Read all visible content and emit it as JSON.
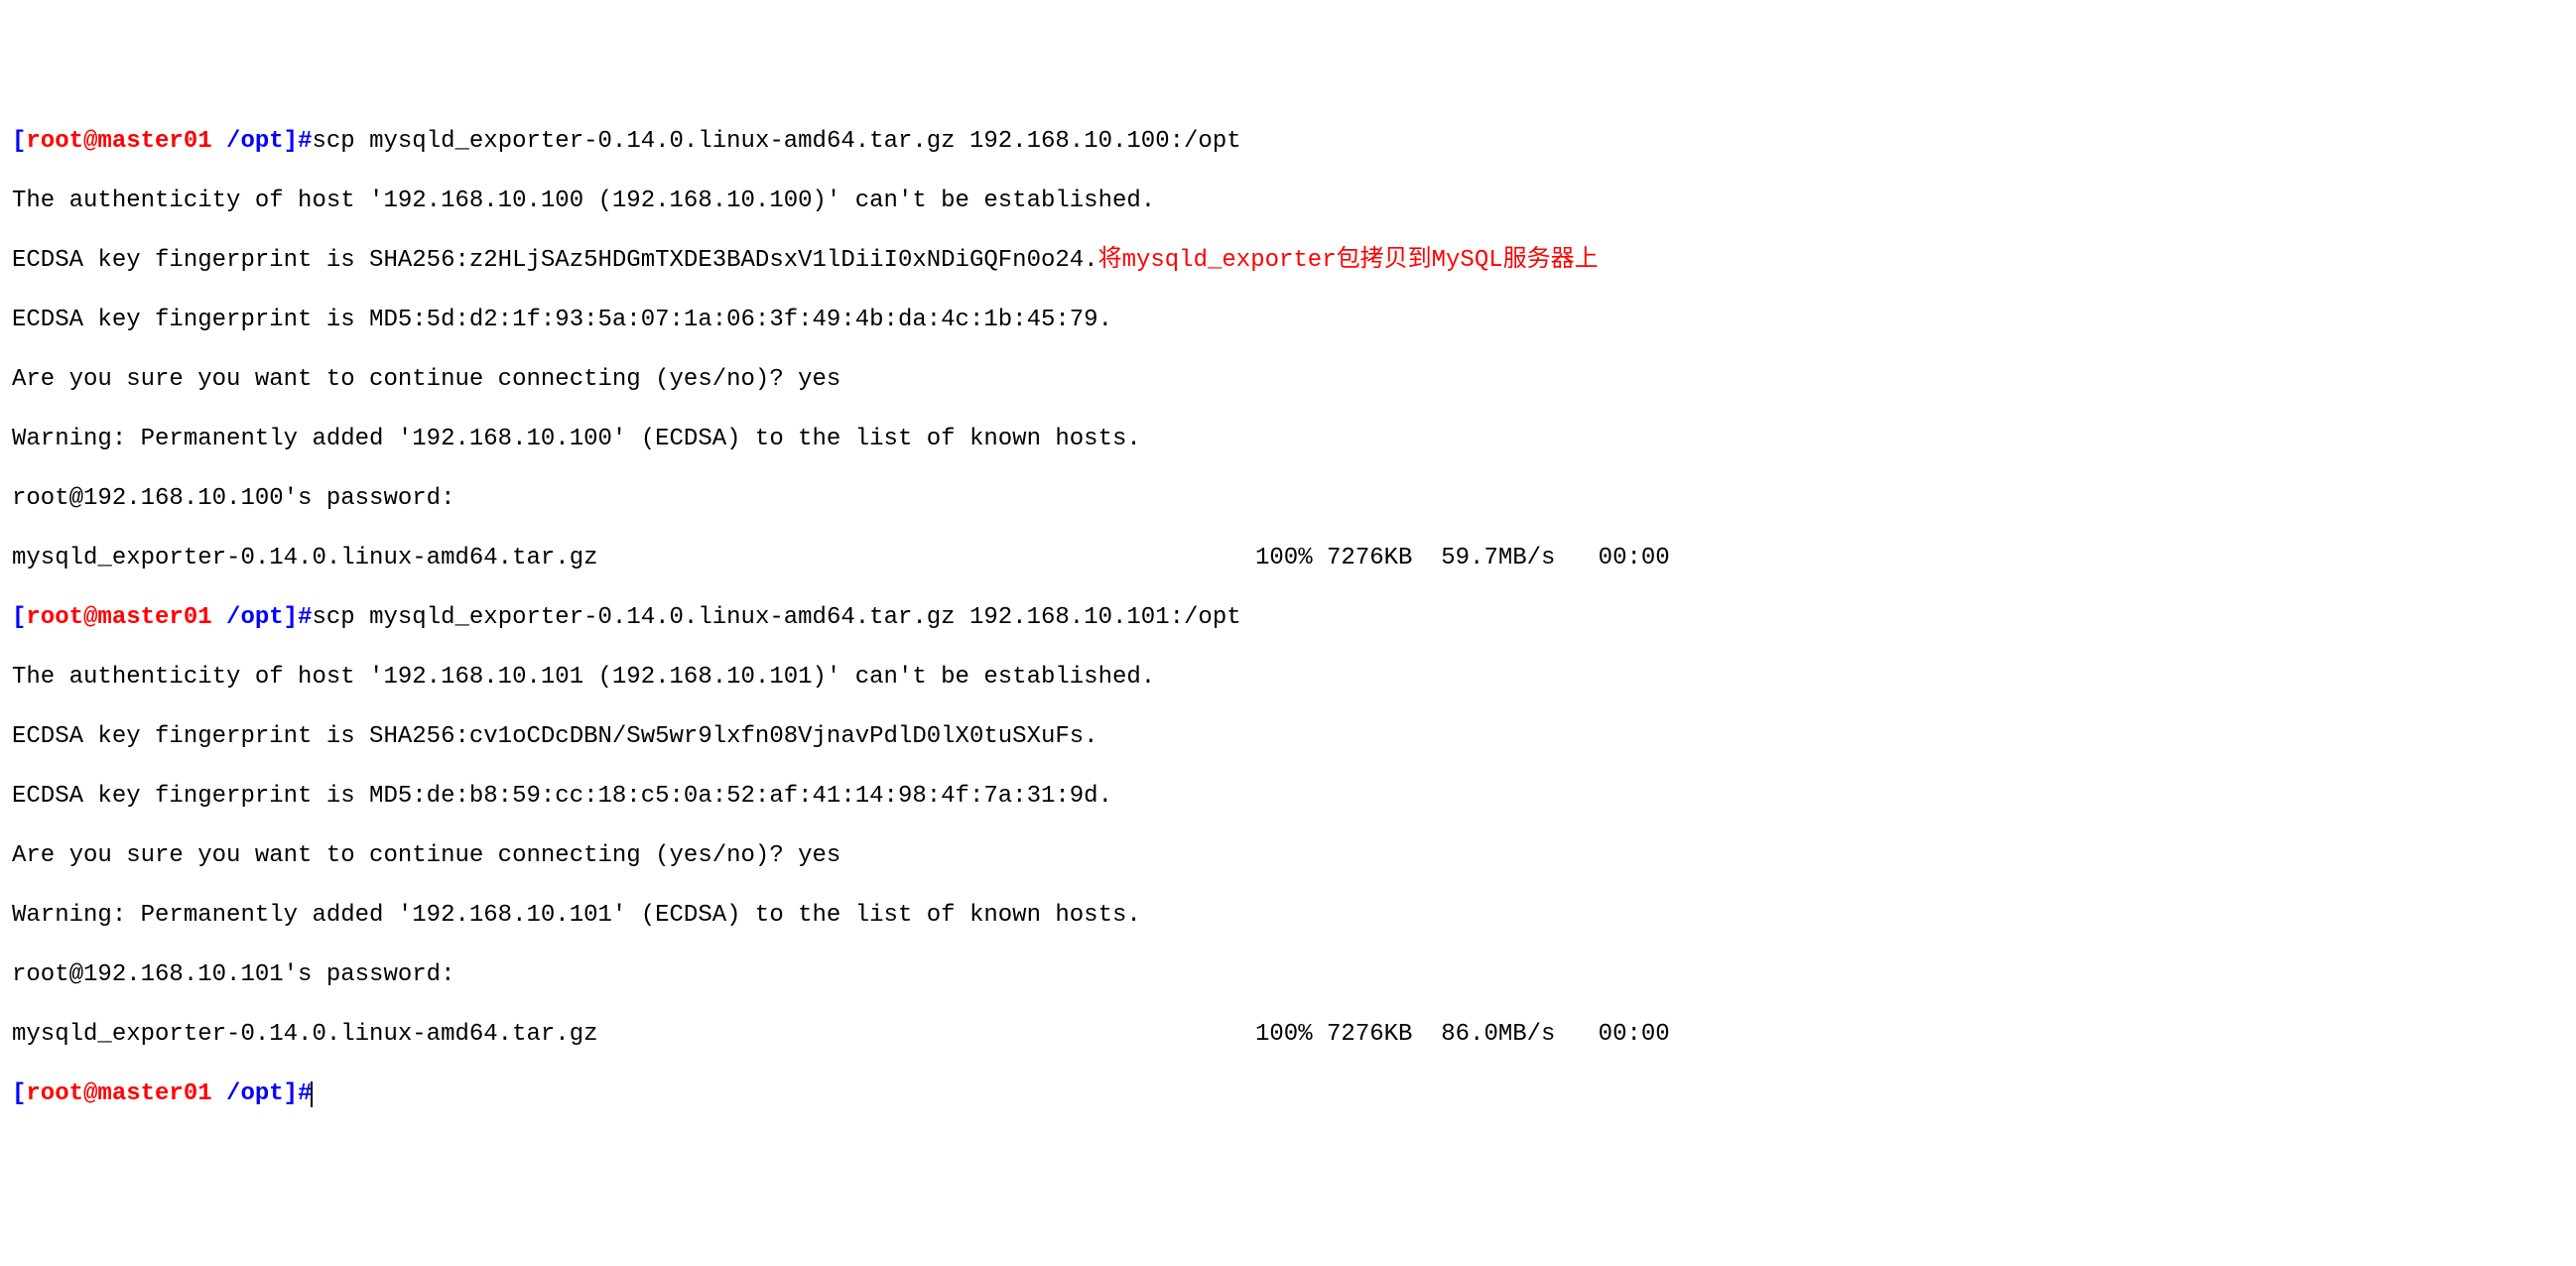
{
  "prompt1": {
    "lbracket": "[",
    "user": "root",
    "at": "@",
    "host": "master01",
    "space": " ",
    "path": "/opt",
    "rbracket": "]",
    "hash": "#",
    "cmd": "scp mysqld_exporter-0.14.0.linux-amd64.tar.gz 192.168.10.100:/opt"
  },
  "block1": {
    "line1": "The authenticity of host '192.168.10.100 (192.168.10.100)' can't be established.",
    "line2": "ECDSA key fingerprint is SHA256:z2HLjSAz5HDGmTXDE3BADsxV1lDiiI0xNDiGQFn0o24.",
    "annotation": "将mysqld_exporter包拷贝到MySQL服务器上",
    "line3": "ECDSA key fingerprint is MD5:5d:d2:1f:93:5a:07:1a:06:3f:49:4b:da:4c:1b:45:79.",
    "line4": "Are you sure you want to continue connecting (yes/no)? yes",
    "line5": "Warning: Permanently added '192.168.10.100' (ECDSA) to the list of known hosts.",
    "line6": "root@192.168.10.100's password: ",
    "progress": "mysqld_exporter-0.14.0.linux-amd64.tar.gz                                              100% 7276KB  59.7MB/s   00:00    "
  },
  "prompt2": {
    "lbracket": "[",
    "user": "root",
    "at": "@",
    "host": "master01",
    "space": " ",
    "path": "/opt",
    "rbracket": "]",
    "hash": "#",
    "cmd": "scp mysqld_exporter-0.14.0.linux-amd64.tar.gz 192.168.10.101:/opt"
  },
  "block2": {
    "line1": "The authenticity of host '192.168.10.101 (192.168.10.101)' can't be established.",
    "line2": "ECDSA key fingerprint is SHA256:cv1oCDcDBN/Sw5wr9lxfn08VjnavPdlD0lX0tuSXuFs.",
    "line3": "ECDSA key fingerprint is MD5:de:b8:59:cc:18:c5:0a:52:af:41:14:98:4f:7a:31:9d.",
    "line4": "Are you sure you want to continue connecting (yes/no)? yes",
    "line5": "Warning: Permanently added '192.168.10.101' (ECDSA) to the list of known hosts.",
    "line6": "root@192.168.10.101's password: ",
    "progress": "mysqld_exporter-0.14.0.linux-amd64.tar.gz                                              100% 7276KB  86.0MB/s   00:00    "
  },
  "prompt3": {
    "lbracket": "[",
    "user": "root",
    "at": "@",
    "host": "master01",
    "space": " ",
    "path": "/opt",
    "rbracket": "]",
    "hash": "#"
  }
}
